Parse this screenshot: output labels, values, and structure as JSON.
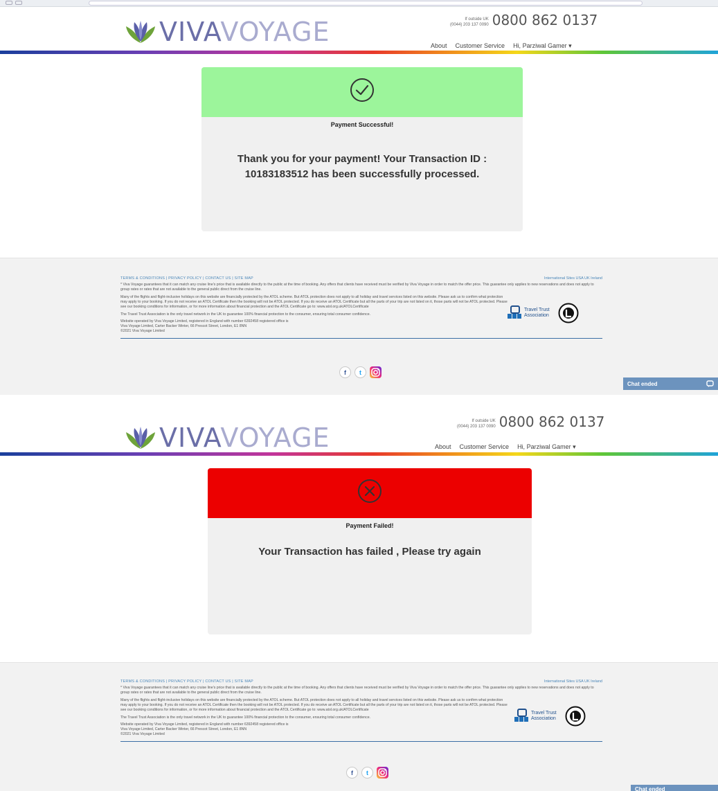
{
  "brand": {
    "name_part1": "VIVA",
    "name_part2": "VOYAGE"
  },
  "header": {
    "phone_small_line1": "If outside UK",
    "phone_small_line2": "(0044) 203 137 0090",
    "phone_number": "0800 862 0137",
    "nav": {
      "about": "About",
      "customer_service": "Customer Service",
      "user_menu": "Hi, Parziwal Gamer ▾"
    }
  },
  "success": {
    "title": "Payment Successful!",
    "message": "Thank you for your payment! Your Transaction ID : 10183183512 has been successfully processed.",
    "header_color": "#9cf59b"
  },
  "failure": {
    "title": "Payment Failed!",
    "message": "Your Transaction has failed , Please try again",
    "header_color": "#ec0000"
  },
  "footer": {
    "links": "TERMS & CONDITIONS | PRIVACY POLICY | CONTACT US | SITE MAP",
    "intl": "International Sites  USA  UK  Ireland",
    "p1": "* Viva Voyage guarantees that it can match any cruise line's price that is available directly to the public at the time of booking. Any offers that clients have received must be verified by Viva Voyage in order to match the offer price. This guarantee only applies to new reservations and does not apply to group rates or rates that are not available to the general public direct from the cruise line.",
    "p2": "Many of the flights and flight-inclusive holidays on this website are financially protected by the ATOL scheme. But ATOL protection does not apply to all holiday and travel services listed on this website. Please ask us to confirm what protection may apply to your booking. If you do not receive an ATOL Certificate then the booking will not be ATOL protected. If you do receive an ATOL Certificate but all the parts of your trip are not listed on it, those parts will not be ATOL protected. Please see our booking conditions for information, or for more information about financial protection and the ATOL Certificate go to: www.atol.org.uk/ATOLCertificate",
    "p3": "The Travel Trust Association is the only travel network in the UK to guarantee 100% financial protection to the consumer, ensuring total consumer confidence.",
    "p4": "Website operated by Viva Voyage Limited, registered in England with number 6392458 registered office is",
    "p5": "Viva Voyage Limited, Carter Backer Winter, 66 Prescot Street, London, E1 8NN",
    "p6": "©2021 Viva Voyage Limited",
    "tta_line1": "Travel Trust",
    "tta_line2": "Association"
  },
  "social": {
    "facebook_icon": "f",
    "twitter_icon": "t",
    "instagram_icon": "instagram-icon"
  },
  "chat": {
    "label": "Chat ended"
  }
}
